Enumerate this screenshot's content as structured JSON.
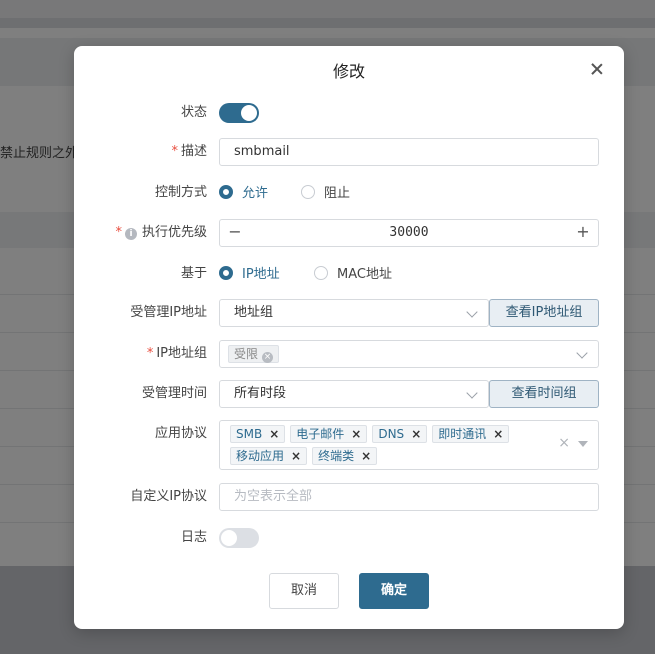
{
  "background": {
    "partial_text": "禁止规则之外"
  },
  "dialog": {
    "title": "修改",
    "fields": {
      "status": {
        "label": "状态",
        "enabled": true
      },
      "description": {
        "label": "描述",
        "required": true,
        "value": "smbmail"
      },
      "control_mode": {
        "label": "控制方式",
        "options": [
          "允许",
          "阻止"
        ],
        "selected": "允许"
      },
      "priority": {
        "label": "执行优先级",
        "required": true,
        "value": "30000",
        "minus": "−",
        "plus": "+"
      },
      "based_on": {
        "label": "基于",
        "options": [
          "IP地址",
          "MAC地址"
        ],
        "selected": "IP地址"
      },
      "managed_ip": {
        "label": "受管理IP地址",
        "value": "地址组",
        "button": "查看IP地址组"
      },
      "ip_group": {
        "label": "IP地址组",
        "required": true,
        "tags": [
          "受限"
        ]
      },
      "managed_time": {
        "label": "受管理时间",
        "value": "所有时段",
        "button": "查看时间组"
      },
      "protocols": {
        "label": "应用协议",
        "tags": [
          "SMB",
          "电子邮件",
          "DNS",
          "即时通讯",
          "移动应用",
          "终端类"
        ]
      },
      "custom_ip_protocol": {
        "label": "自定义IP协议",
        "placeholder": "为空表示全部",
        "value": ""
      },
      "log": {
        "label": "日志",
        "enabled": false
      }
    },
    "buttons": {
      "cancel": "取消",
      "confirm": "确定"
    },
    "required_mark": "*",
    "info_mark": "i",
    "tag_remove": "×"
  },
  "colors": {
    "primary": "#2e6b8f",
    "required": "#e84c3d"
  }
}
